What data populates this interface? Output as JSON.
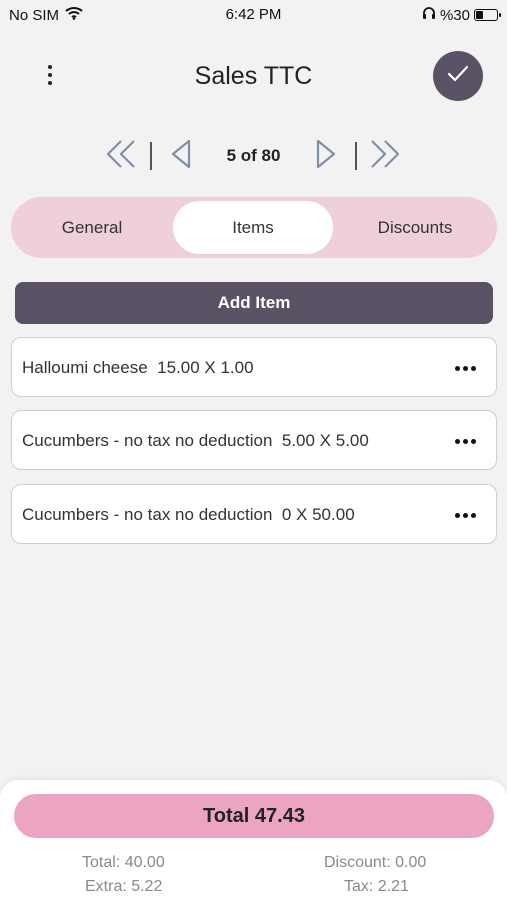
{
  "status_bar": {
    "carrier": "No SIM",
    "time": "6:42 PM",
    "battery": "%30",
    "wifi_icon": "wifi-icon",
    "headphones_icon": "headphones-icon",
    "battery_icon": "battery-icon"
  },
  "header": {
    "title": "Sales TTC",
    "menu_icon": "vertical-dots-icon",
    "confirm_icon": "checkmark-icon"
  },
  "pager": {
    "label": "5 of 80",
    "first_icon": "double-chevron-left-icon",
    "prev_icon": "triangle-left-icon",
    "next_icon": "triangle-right-icon",
    "last_icon": "double-chevron-right-icon"
  },
  "tabs": [
    {
      "label": "General",
      "active": false
    },
    {
      "label": "Items",
      "active": true
    },
    {
      "label": "Discounts",
      "active": false
    }
  ],
  "add_item_label": "Add Item",
  "items": [
    {
      "text": "Halloumi cheese  15.00 X 1.00"
    },
    {
      "text": "Cucumbers - no tax no deduction  5.00 X 5.00"
    },
    {
      "text": "Cucumbers - no tax no deduction  0 X 50.00"
    }
  ],
  "footer": {
    "total_label": "Total 47.43",
    "total": "Total: 40.00",
    "discount": "Discount: 0.00",
    "extra": "Extra: 5.22",
    "tax": "Tax: 2.21"
  },
  "colors": {
    "accent_dark": "#5a5264",
    "tabs_bg": "#efcfdb",
    "total_pink": "#eba4c2",
    "background": "#f2f2f2"
  }
}
